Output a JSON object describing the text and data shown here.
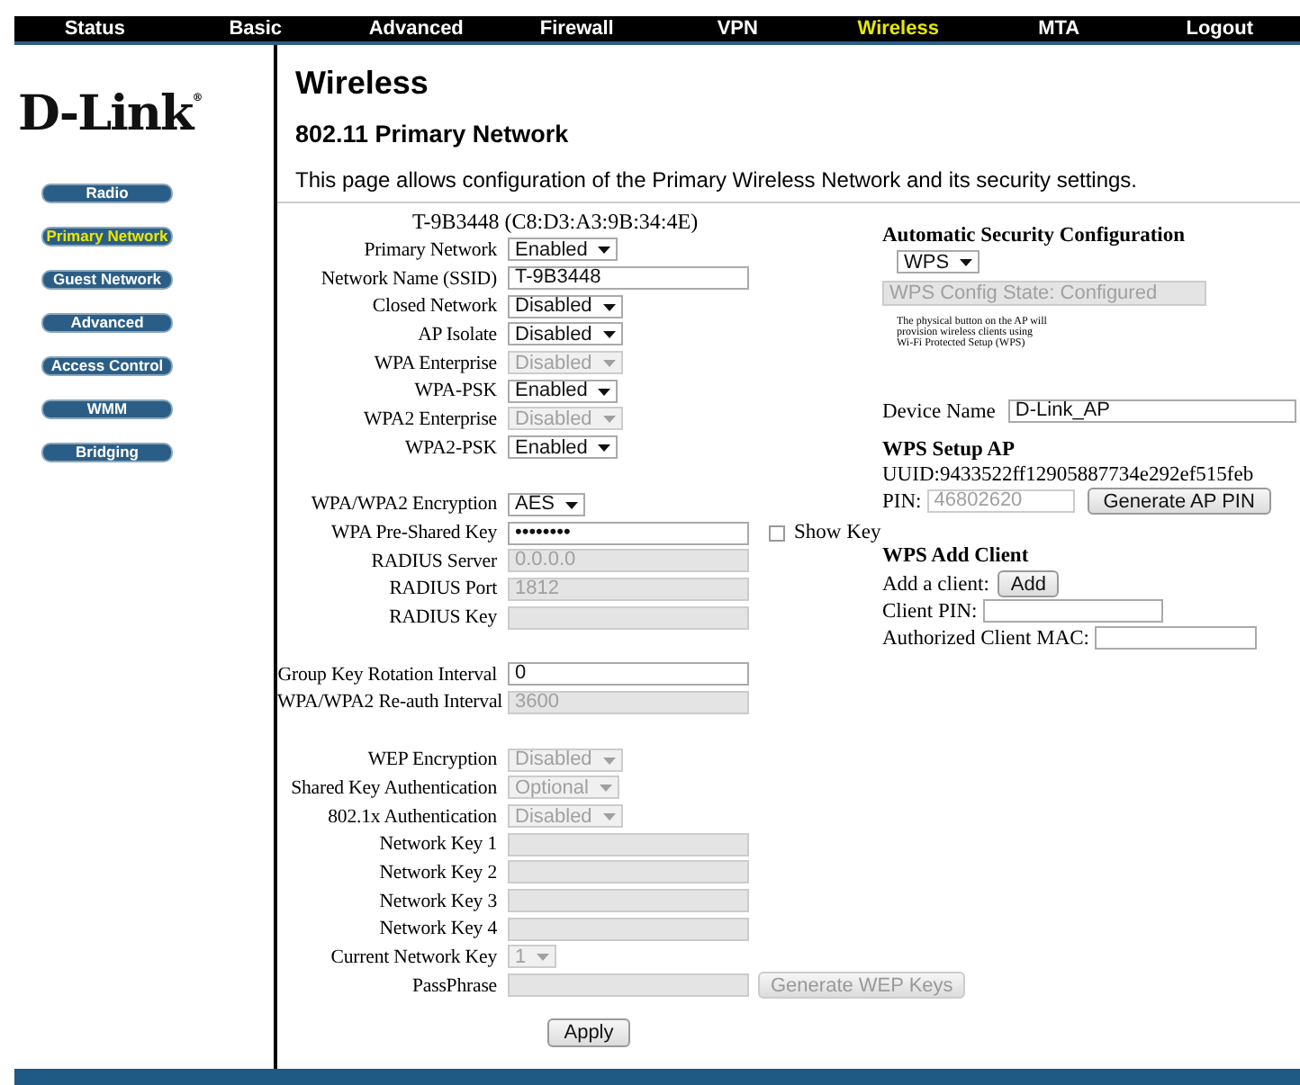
{
  "nav": [
    {
      "label": "Status",
      "selected": false
    },
    {
      "label": "Basic",
      "selected": false
    },
    {
      "label": "Advanced",
      "selected": false
    },
    {
      "label": "Firewall",
      "selected": false
    },
    {
      "label": "VPN",
      "selected": false
    },
    {
      "label": "Wireless",
      "selected": true
    },
    {
      "label": "MTA",
      "selected": false
    },
    {
      "label": "Logout",
      "selected": false
    }
  ],
  "sidebar": {
    "logo": "D-Link$^{®}$",
    "items": [
      {
        "label": "Radio",
        "selected": false
      },
      {
        "label": "Primary Network",
        "selected": true
      },
      {
        "label": "Guest Network",
        "selected": false
      },
      {
        "label": "Advanced",
        "selected": false
      },
      {
        "label": "Access Control",
        "selected": false
      },
      {
        "label": "WMM",
        "selected": false
      },
      {
        "label": "Bridging",
        "selected": false
      }
    ]
  },
  "page": {
    "title": "Wireless",
    "subtitle": "802.11 Primary Network",
    "description": "This page allows configuration of the Primary Wireless Network and its security settings."
  },
  "form": {
    "device_line": "T-9B3448 (C8:D3:A3:9B:34:4E)",
    "groups": [
      [
        {
          "label": "Primary Network",
          "kind": "select",
          "value": "Enabled",
          "disabled": false
        },
        {
          "label": "Network Name (SSID)",
          "kind": "text",
          "value": "T-9B3448",
          "disabled": false
        },
        {
          "label": "Closed Network",
          "kind": "select",
          "value": "Disabled",
          "disabled": false
        },
        {
          "label": "AP Isolate",
          "kind": "select",
          "value": "Disabled",
          "disabled": false
        },
        {
          "label": "WPA Enterprise",
          "kind": "select",
          "value": "Disabled",
          "disabled": true
        },
        {
          "label": "WPA-PSK",
          "kind": "select",
          "value": "Enabled",
          "disabled": false
        },
        {
          "label": "WPA2 Enterprise",
          "kind": "select",
          "value": "Disabled",
          "disabled": true
        },
        {
          "label": "WPA2-PSK",
          "kind": "select",
          "value": "Enabled",
          "disabled": false
        }
      ],
      [
        {
          "label": "WPA/WPA2 Encryption",
          "kind": "select",
          "value": "AES",
          "disabled": false
        },
        {
          "label": "WPA Pre-Shared Key",
          "kind": "text",
          "value": "••••••••",
          "disabled": false,
          "show_key": {
            "label": "Show Key",
            "checked": false
          }
        },
        {
          "label": "RADIUS Server",
          "kind": "text",
          "value": "0.0.0.0",
          "disabled": true
        },
        {
          "label": "RADIUS Port",
          "kind": "text",
          "value": "1812",
          "disabled": true
        },
        {
          "label": "RADIUS Key",
          "kind": "text",
          "disabled": true
        }
      ],
      [
        {
          "label": "Group Key Rotation Interval",
          "kind": "text",
          "value": "0",
          "disabled": false
        },
        {
          "label": "WPA/WPA2 Re-auth Interval",
          "kind": "text",
          "value": "3600",
          "disabled": true
        }
      ],
      [
        {
          "label": "WEP Encryption",
          "kind": "select",
          "value": "Disabled",
          "disabled": true
        },
        {
          "label": "Shared Key Authentication",
          "kind": "select",
          "value": "Optional",
          "disabled": true
        },
        {
          "label": "802.1x Authentication",
          "kind": "select",
          "value": "Disabled",
          "disabled": true
        },
        {
          "label": "Network Key 1",
          "kind": "text",
          "disabled": true
        },
        {
          "label": "Network Key 2",
          "kind": "text",
          "disabled": true
        },
        {
          "label": "Network Key 3",
          "kind": "text",
          "disabled": true
        },
        {
          "label": "Network Key 4",
          "kind": "text",
          "disabled": true
        },
        {
          "label": "Current Network Key",
          "kind": "select",
          "value": "1",
          "disabled": true
        },
        {
          "label": "PassPhrase",
          "kind": "text",
          "disabled": true,
          "button": {
            "label": "Generate WEP Keys",
            "disabled": true
          }
        }
      ]
    ],
    "apply_button": "Apply"
  },
  "security": {
    "heading": "Automatic Security Configuration",
    "mode": "WPS",
    "state_field": {
      "value": "WPS Config State: Configured",
      "disabled": true
    },
    "note": "The physical button on the AP will provision wireless clients using Wi-Fi Protected Setup (WPS)"
  },
  "device_name": {
    "label": "Device Name",
    "value": "D-Link_AP"
  },
  "wps_setup_ap": {
    "heading": "WPS Setup AP",
    "uuid": "UUID:9433522ff12905887734e292ef515feb",
    "pin_label": "PIN:",
    "pin_value": "46802620",
    "pin_disabled": true,
    "button": "Generate AP PIN"
  },
  "wps_add_client": {
    "heading": "WPS Add Client",
    "add_label": "Add a client:",
    "add_button": "Add",
    "client_pin_label": "Client PIN:",
    "mac_label": "Authorized Client MAC:"
  }
}
